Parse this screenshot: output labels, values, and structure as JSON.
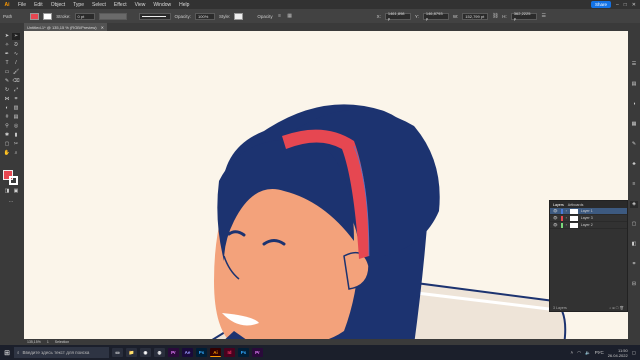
{
  "app": {
    "logo": "Ai",
    "menu": [
      "File",
      "Edit",
      "Object",
      "Type",
      "Select",
      "Effect",
      "View",
      "Window",
      "Help"
    ],
    "share_label": "Share",
    "window_controls": {
      "minimize": "–",
      "maximize": "□",
      "close": "✕"
    }
  },
  "control_bar": {
    "path_label": "Path",
    "stroke_label": "Stroke:",
    "opacity_label": "Opacity:",
    "opacity_value": "100%",
    "style_label": "Style:",
    "opacity_field_label": "Opacity",
    "stroke_value": "0 pt",
    "x_label": "X:",
    "x_value": "1461,898 p",
    "y_label": "Y:",
    "y_value": "146,8793 p",
    "w_label": "W:",
    "w_value": "152,799 pt",
    "h_label": "H:",
    "h_value": "362,2225 p",
    "fill_color": "#e64751"
  },
  "document": {
    "tab_title": "Untitled-1* @ 135,15 % (RGB/Preview)",
    "tab_close": "✕"
  },
  "status": {
    "zoom": "135,15%",
    "artboard": "1",
    "info": "Selection"
  },
  "layers_panel": {
    "tabs": [
      "Layers",
      "Artboards"
    ],
    "layers": [
      {
        "name": "Layer 1",
        "selected": true
      },
      {
        "name": "Layer 3",
        "selected": false
      },
      {
        "name": "Layer 2",
        "selected": false
      }
    ],
    "footer": "3 Layers"
  },
  "taskbar": {
    "search_placeholder": "Введите здесь текст для поиска",
    "apps": [
      "Pr",
      "Ae",
      "Ps",
      "Ai",
      "Id",
      "Ps",
      "Pr"
    ],
    "language": "РУС",
    "time": "11:50",
    "date": "26.04.2022"
  },
  "colors": {
    "hair": "#1c3370",
    "skin": "#f3a27b",
    "headband": "#e64751",
    "canvas": "#fbf5ea"
  }
}
